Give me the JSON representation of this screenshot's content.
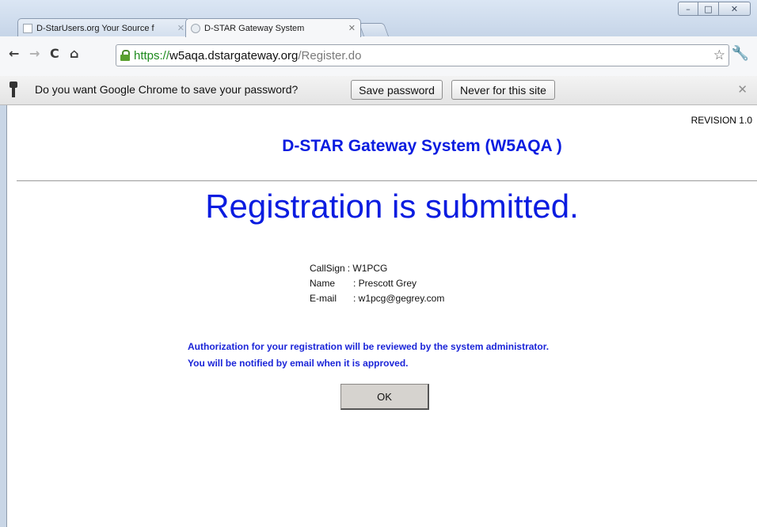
{
  "window": {
    "controls": {
      "minimize": "–",
      "maximize": "□",
      "close": "✕"
    }
  },
  "tabs": [
    {
      "title": "D-StarUsers.org Your Source f",
      "close": "✕",
      "active": false
    },
    {
      "title": "D-STAR Gateway System",
      "close": "✕",
      "active": true
    }
  ],
  "toolbar": {
    "back": "←",
    "forward": "→",
    "reload": "C",
    "home": "⌂",
    "url": {
      "scheme": "https://",
      "host": "w5aqa.dstargateway.org",
      "path": "/Register.do"
    },
    "star": "☆",
    "wrench": "🔧"
  },
  "infobar": {
    "message": "Do you want Google Chrome to save your password?",
    "save_button": "Save password",
    "never_button": "Never for this site",
    "close": "✕"
  },
  "page": {
    "revision": "REVISION 1.0",
    "title": "D-STAR Gateway System (W5AQA )",
    "headline": "Registration is submitted.",
    "details": {
      "callsign_label": "CallSign",
      "callsign_value": ": W1PCG",
      "name_label": "Name",
      "name_value": ": Prescott Grey",
      "email_label": "E-mail",
      "email_value": ": w1pcg@gegrey.com"
    },
    "notice_line1": "Authorization for your registration will be reviewed by the system administrator.",
    "notice_line2": "You will be notified by email when it is approved.",
    "ok_button": "OK"
  },
  "colors": {
    "title_blue": "#0a1ce0",
    "notice_blue": "#1b25d8",
    "secure_green": "#1e8a1e"
  }
}
